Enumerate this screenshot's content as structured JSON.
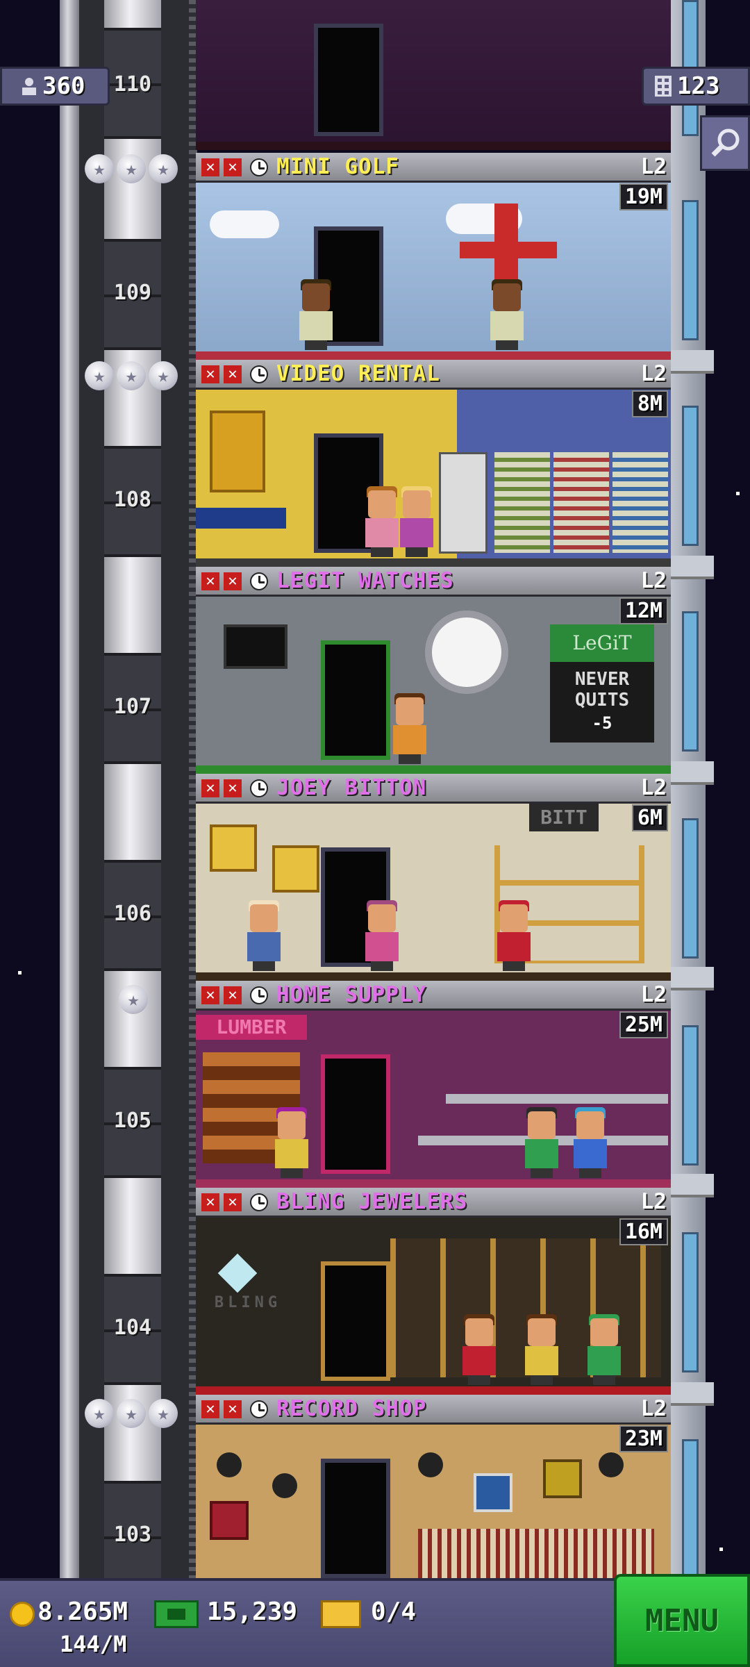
{
  "top_bar": {
    "population": "360",
    "floor_count": "123"
  },
  "floors": [
    {
      "number": "110",
      "name": "",
      "level": "",
      "stock": ""
    },
    {
      "number": "109",
      "name": "MINI GOLF",
      "level": "L2",
      "stock": "19M",
      "stars": 3,
      "name_color": "#ffee55"
    },
    {
      "number": "108",
      "name": "VIDEO RENTAL",
      "level": "L2",
      "stock": "8M",
      "stars": 3,
      "name_color": "#ffee55"
    },
    {
      "number": "107",
      "name": "LEGIT WATCHES",
      "level": "L2",
      "stock": "12M",
      "stars": 0,
      "name_color": "#e070e8",
      "room_sign_1": "LeGiT",
      "room_sign_2": "NEVER",
      "room_sign_3": "QUITS",
      "room_sign_4": "-5"
    },
    {
      "number": "106",
      "name": "JOEY BITTON",
      "level": "L2",
      "stock": "6M",
      "stars": 0,
      "name_color": "#e070e8",
      "room_sign": "BITT"
    },
    {
      "number": "105",
      "name": "HOME SUPPLY",
      "level": "L2",
      "stock": "25M",
      "stars": 1,
      "name_color": "#e070e8",
      "room_sign": "LUMBER"
    },
    {
      "number": "104",
      "name": "BLING JEWELERS",
      "level": "L2",
      "stock": "16M",
      "stars": 0,
      "name_color": "#e070e8",
      "room_sign": "BLING"
    },
    {
      "number": "103",
      "name": "RECORD SHOP",
      "level": "L2",
      "stock": "23M",
      "stars": 3,
      "name_color": "#e070e8"
    }
  ],
  "bottom_bar": {
    "coins": "8.265M",
    "coins_rate": "144/M",
    "bux": "15,239",
    "tickets": "0/4",
    "menu_label": "MENU"
  },
  "colors": {
    "background": "#0d0a1f",
    "menu_green": "#22b832",
    "badge": "#5a5a7e"
  },
  "icons": [
    "person-icon",
    "floors-icon",
    "search-icon",
    "star-icon",
    "clock-icon",
    "coin-icon",
    "bux-icon",
    "ticket-icon"
  ]
}
